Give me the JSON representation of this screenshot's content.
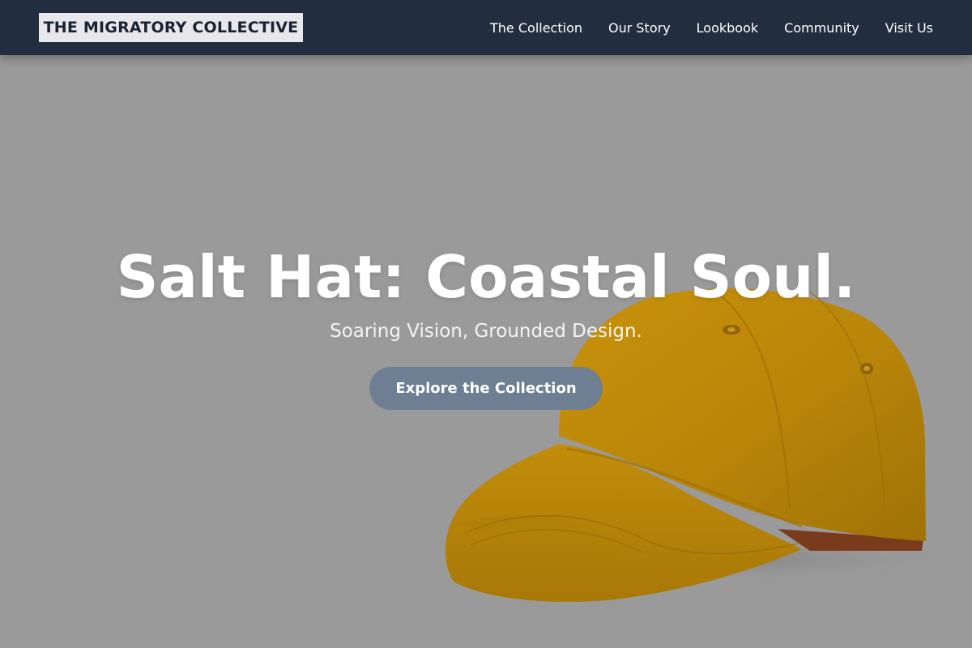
{
  "header": {
    "logo_text": "THE MIGRATORY COLLECTIVE",
    "nav": [
      {
        "label": "The Collection"
      },
      {
        "label": "Our Story"
      },
      {
        "label": "Lookbook"
      },
      {
        "label": "Community"
      },
      {
        "label": "Visit Us"
      }
    ]
  },
  "hero": {
    "title": "Salt Hat: Coastal Soul.",
    "subtitle": "Soaring Vision, Grounded Design.",
    "cta_label": "Explore the Collection",
    "image": "yellow-baseball-cap"
  },
  "colors": {
    "header_bg": "#222e3f",
    "logo_bg": "#e8e8ec",
    "hero_overlay": "#9a9a9a",
    "cta_bg": "#6e7f94",
    "cap_yellow": "#d9a20c"
  }
}
